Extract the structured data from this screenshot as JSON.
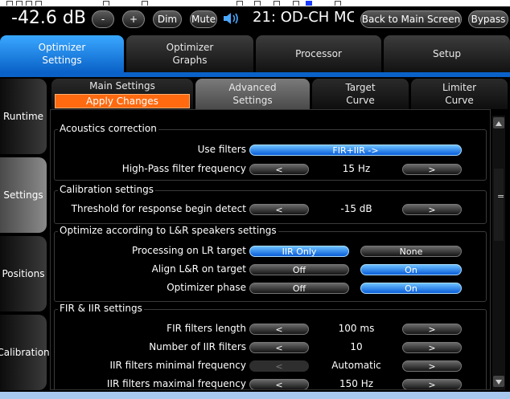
{
  "header": {
    "gain": "-42.6 dB",
    "minus_label": "-",
    "plus_label": "+",
    "dim_label": "Dim",
    "mute_label": "Mute",
    "preset": "21: OD-CH MC",
    "back_label": "Back to Main Screen",
    "bypass_label": "Bypass"
  },
  "main_tabs": [
    {
      "line1": "Optimizer",
      "line2": "Settings"
    },
    {
      "line1": "Optimizer",
      "line2": "Graphs"
    },
    {
      "line1": "Processor",
      "line2": ""
    },
    {
      "line1": "Setup",
      "line2": ""
    }
  ],
  "sidebar": [
    "Runtime",
    "Settings",
    "Positions",
    "Calibration"
  ],
  "sub_tabs": {
    "main": {
      "line1": "Main Settings",
      "apply": "Apply Changes"
    },
    "advanced": {
      "line1": "Advanced",
      "line2": "Settings"
    },
    "target": {
      "line1": "Target",
      "line2": "Curve"
    },
    "limiter": {
      "line1": "Limiter",
      "line2": "Curve"
    }
  },
  "acoustics": {
    "title": "Acoustics correction",
    "use_filters_label": "Use filters",
    "use_filters_value": "FIR+IIR ->",
    "hp_label": "High-Pass filter frequency",
    "hp_value": "15 Hz"
  },
  "calibration": {
    "title": "Calibration settings",
    "threshold_label": "Threshold for response begin detect",
    "threshold_value": "-15 dB"
  },
  "optimize": {
    "title": "Optimize according to L&R speakers settings",
    "processing_label": "Processing on LR target",
    "processing_opt1": "IIR Only",
    "processing_opt2": "None",
    "align_label": "Align L&R on target",
    "align_off": "Off",
    "align_on": "On",
    "phase_label": "Optimizer phase",
    "phase_off": "Off",
    "phase_on": "On"
  },
  "firiir": {
    "title": "FIR & IIR settings",
    "fir_len_label": "FIR filters length",
    "fir_len_value": "100 ms",
    "iir_num_label": "Number of IIR filters",
    "iir_num_value": "10",
    "iir_min_label": "IIR filters minimal frequency",
    "iir_min_value": "Automatic",
    "iir_max_label": "IIR filters maximal frequency",
    "iir_max_value": "150 Hz"
  },
  "arrows": {
    "left": "<",
    "right": ">"
  },
  "scrollbar": {
    "side_label": "="
  },
  "colors": {
    "accent_blue": "#0a62c8",
    "apply_orange": "#ff6a10"
  }
}
